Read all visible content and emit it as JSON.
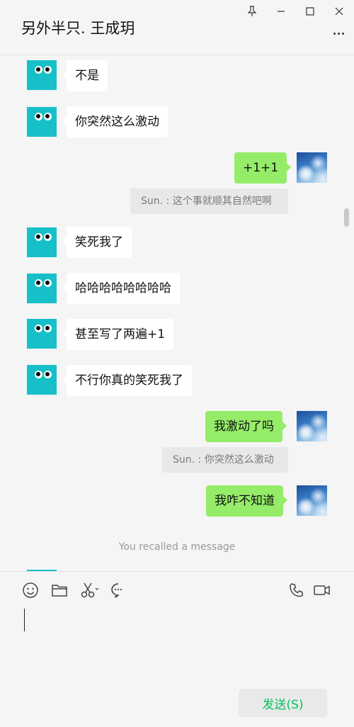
{
  "window": {
    "title": "另外半只. 王成玥",
    "controls": [
      "pin-icon",
      "minimize-icon",
      "maximize-icon",
      "close-icon"
    ]
  },
  "messages": {
    "m1": "不是",
    "m2": "你突然这么激动",
    "m3": "+1+1",
    "q1": "Sun. : 这个事就顺其自然吧啊",
    "m4": "笑死我了",
    "m5": "哈哈哈哈哈哈哈哈",
    "m6": "甚至写了两遍+1",
    "m7": "不行你真的笑死我了",
    "m8": "我激动了吗",
    "q2": "Sun. : 你突然这么激动",
    "m9": "我咋不知道",
    "recalled": "You recalled a message"
  },
  "toolbar": {
    "icons": [
      "emoji-icon",
      "folder-icon",
      "scissors-icon",
      "chat-history-icon",
      "phone-icon",
      "video-icon"
    ]
  },
  "input": {
    "value": ""
  },
  "send_button": {
    "label": "发送(S)"
  },
  "colors": {
    "green_bubble": "#95ec69",
    "send_text": "#07c160",
    "robot_avatar": "#17c0c8"
  }
}
